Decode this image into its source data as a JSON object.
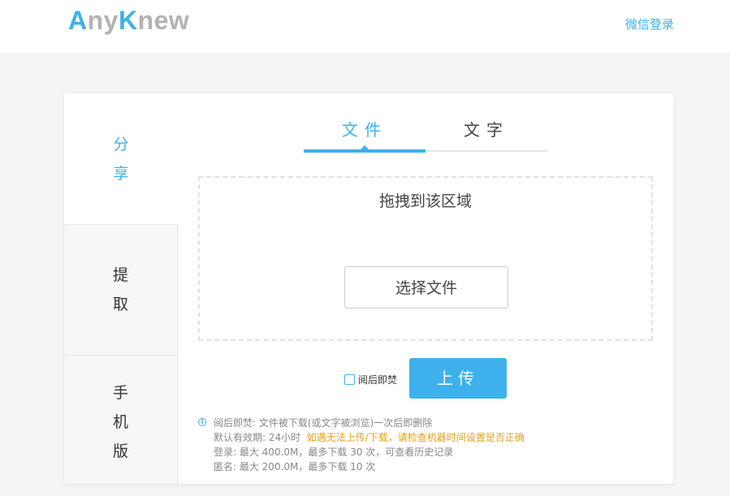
{
  "header": {
    "logo": {
      "part1": "A",
      "part2": "ny",
      "part3": "K",
      "part4": "new"
    },
    "login_link": "微信登录"
  },
  "sidebar": {
    "items": [
      {
        "chars": [
          "分",
          "享"
        ]
      },
      {
        "chars": [
          "提",
          "取"
        ]
      },
      {
        "chars": [
          "手",
          "机",
          "版"
        ]
      }
    ]
  },
  "tabs": [
    {
      "label": "文件"
    },
    {
      "label": "文字"
    }
  ],
  "dropzone": {
    "title": "拖拽到该区域",
    "choose_button": "选择文件"
  },
  "burn_after_reading": {
    "label": "阅后即焚",
    "checked": false
  },
  "upload_button": "上传",
  "notes": {
    "line1": "阅后即焚: 文件被下载(或文字被浏览)一次后即删除",
    "line2_prefix": "默认有效期: 24小时",
    "line2_warning": "如遇无法上传/下载，请检查机器时间设置是否正确",
    "line3": "登录: 最大 400.0M，最多下载 30 次，可查看历史记录",
    "line4": "匿名: 最大 200.0M，最多下载 10 次"
  },
  "colors": {
    "accent": "#3eb1ec",
    "warning": "#e5a11c"
  },
  "icons": {
    "info": "info-icon",
    "checkbox": "checkbox-icon"
  }
}
